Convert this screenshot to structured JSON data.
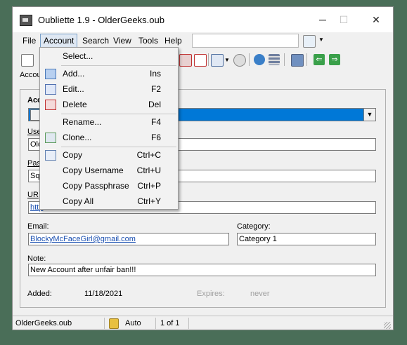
{
  "window": {
    "title": "Oubliette 1.9 - OlderGeeks.oub",
    "minimize": "─",
    "maximize": "☐",
    "close": "✕"
  },
  "menubar": {
    "items": [
      "File",
      "Account",
      "Search",
      "View",
      "Tools",
      "Help"
    ],
    "search_value": ""
  },
  "breadcrumb": "Accou",
  "account_menu": {
    "items": [
      {
        "label": "Select...",
        "shortcut": "",
        "icon": "none"
      },
      {
        "label": "Add...",
        "shortcut": "Ins",
        "icon": "folder-icon"
      },
      {
        "label": "Edit...",
        "shortcut": "F2",
        "icon": "edit-icon"
      },
      {
        "label": "Delete",
        "shortcut": "Del",
        "icon": "delete-icon"
      },
      {
        "label": "Rename...",
        "shortcut": "F4",
        "icon": "none"
      },
      {
        "label": "Clone...",
        "shortcut": "F6",
        "icon": "clone-icon"
      },
      {
        "label": "Copy",
        "shortcut": "Ctrl+C",
        "icon": "copy-icon"
      },
      {
        "label": "Copy Username",
        "shortcut": "Ctrl+U",
        "icon": "none"
      },
      {
        "label": "Copy Passphrase",
        "shortcut": "Ctrl+P",
        "icon": "none"
      },
      {
        "label": "Copy All",
        "shortcut": "Ctrl+Y",
        "icon": "none"
      }
    ]
  },
  "form": {
    "account_label": "Acc",
    "username_label": "Use",
    "username_value": "Old",
    "passphrase_label": "Pas",
    "passphrase_value": "Sq",
    "url_label": "UR",
    "url_value": "http",
    "email_label": "Email:",
    "email_value": "BlockyMcFaceGirl@gmail.com",
    "category_label": "Category:",
    "category_value": "Category 1",
    "note_label": "Note:",
    "note_value": "New Account after unfair ban!!!",
    "added_label": "Added:",
    "added_value": "11/18/2021",
    "expires_label": "Expires:",
    "expires_value": "never"
  },
  "statusbar": {
    "file": "OlderGeeks.oub",
    "mode": "Auto",
    "pager": "1 of 1"
  },
  "colors": {
    "selection": "#0078d7",
    "link": "#1a4fb0",
    "desktop": "#4a6e58"
  }
}
